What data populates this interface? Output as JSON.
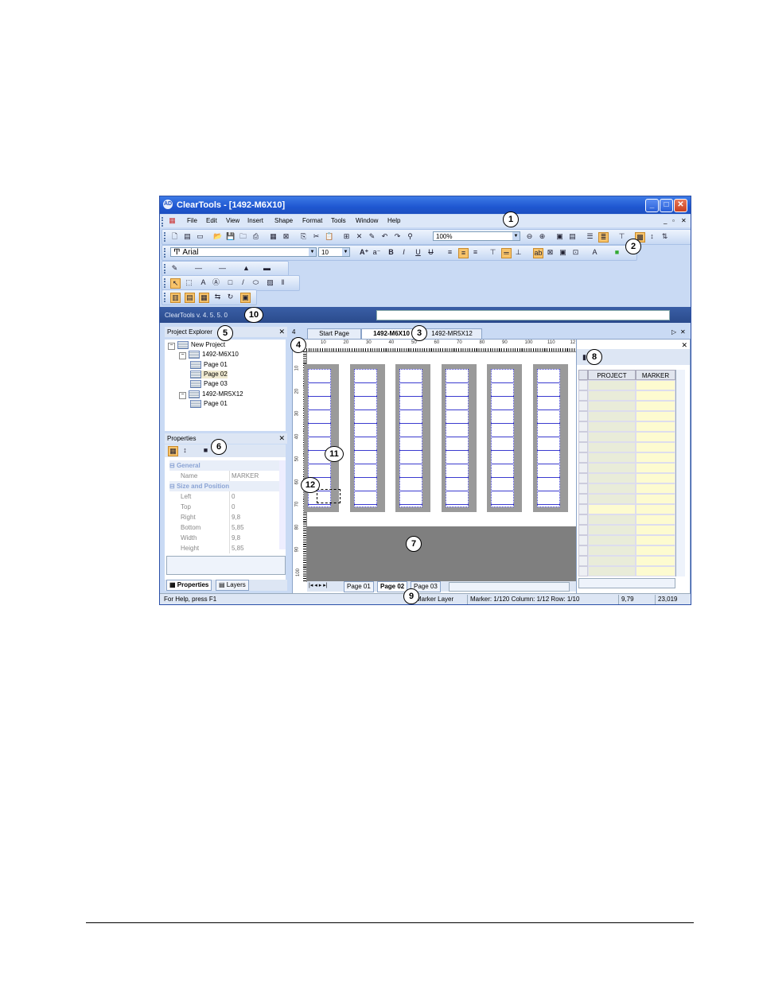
{
  "window": {
    "title": "ClearTools - [1492-M6X10]",
    "app_icon_text": "AD"
  },
  "menu": [
    "File",
    "Edit",
    "View",
    "Insert",
    "Shape",
    "Format",
    "Tools",
    "Window",
    "Help"
  ],
  "toolbar": {
    "zoom": "100%",
    "font": "Arial",
    "font_size": "10"
  },
  "version": {
    "text": "ClearTools v. 4. 5. 5. 0"
  },
  "project_explorer": {
    "title": "Project Explorer",
    "tree": [
      {
        "label": "New Project",
        "level": 0,
        "kind": "project"
      },
      {
        "label": "1492-M6X10",
        "level": 1,
        "kind": "doc"
      },
      {
        "label": "Page 01",
        "level": 2,
        "kind": "page"
      },
      {
        "label": "Page 02",
        "level": 2,
        "kind": "page",
        "selected": true
      },
      {
        "label": "Page 03",
        "level": 2,
        "kind": "page"
      },
      {
        "label": "1492-MR5X12",
        "level": 1,
        "kind": "doc"
      },
      {
        "label": "Page 01",
        "level": 2,
        "kind": "page"
      }
    ]
  },
  "properties": {
    "title": "Properties",
    "categories": {
      "general": "General",
      "size": "Size and Position"
    },
    "name_row": {
      "key": "Name",
      "value": "MARKER"
    },
    "rows": [
      {
        "key": "Left",
        "value": "0"
      },
      {
        "key": "Top",
        "value": "0"
      },
      {
        "key": "Right",
        "value": "9,8"
      },
      {
        "key": "Bottom",
        "value": "5,85"
      },
      {
        "key": "Width",
        "value": "9,8"
      },
      {
        "key": "Height",
        "value": "5,85"
      }
    ],
    "tabs": [
      "Properties",
      "Layers"
    ]
  },
  "doc_tabs": {
    "nav": "4",
    "tabs": [
      "Start Page",
      "1492-M6X10",
      "1492-MR5X12"
    ],
    "active": 1
  },
  "ruler": {
    "h": [
      "10",
      "20",
      "30",
      "40",
      "50",
      "60",
      "70",
      "80",
      "90",
      "100",
      "110",
      "12"
    ],
    "v": [
      "10",
      "20",
      "30",
      "40",
      "50",
      "60",
      "70",
      "80",
      "90",
      "100"
    ]
  },
  "page_tabs": {
    "tabs": [
      "Page 01",
      "Page 02",
      "Page 03"
    ],
    "active": 1
  },
  "data_panel": {
    "columns": [
      "PROJECT",
      "MARKER"
    ]
  },
  "status": {
    "help": "For Help, press F1",
    "layer": "Marker Layer",
    "position": "Marker: 1/120 Column: 1/12 Row: 1/10",
    "x": "9,79",
    "y": "23,019"
  },
  "callouts": [
    "1",
    "2",
    "3",
    "4",
    "5",
    "6",
    "7",
    "8",
    "9",
    "10",
    "11",
    "12"
  ]
}
